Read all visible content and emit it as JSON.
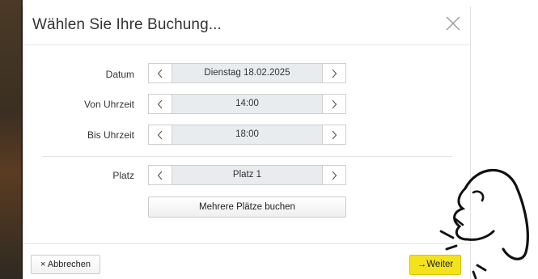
{
  "modal": {
    "title": "Wählen Sie Ihre Buchung...",
    "close_icon": "close-icon"
  },
  "fields": [
    {
      "label": "Datum",
      "value": "Dienstag 18.02.2025"
    },
    {
      "label": "Von Uhrzeit",
      "value": "14:00"
    },
    {
      "label": "Bis Uhrzeit",
      "value": "18:00"
    },
    {
      "label": "Platz",
      "value": "Platz 1"
    }
  ],
  "icons": {
    "prev": "chevron-left-icon",
    "next": "chevron-right-icon"
  },
  "multi_button": "Mehrere Plätze buchen",
  "footer": {
    "cancel_symbol": "×",
    "cancel_label": "Abbrechen",
    "next_symbol": "→",
    "next_label": "Weiter"
  },
  "colors": {
    "accent": "#f3e21c",
    "stepper_bg": "#e9ecee",
    "border": "#cfcfcf"
  }
}
